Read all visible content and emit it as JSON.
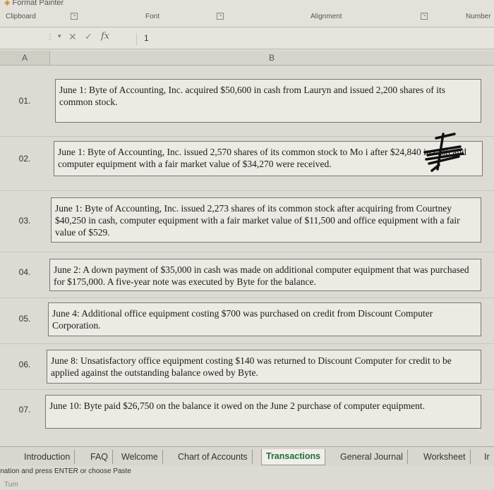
{
  "ribbon": {
    "format_painter": "Format Painter",
    "groups": [
      "Clipboard",
      "Font",
      "Alignment",
      "Number"
    ]
  },
  "formula_bar": {
    "value": "1"
  },
  "columns": [
    "A",
    "B"
  ],
  "rows": [
    {
      "num": "01.",
      "text": "June 1: Byte of Accounting, Inc. acquired $50,600 in cash from Lauryn and issued 2,200 shares of its common stock."
    },
    {
      "num": "02.",
      "text": "June 1: Byte of Accounting, Inc. issued 2,570 shares of its common stock to Mo      i after $24,840 in cash and computer equipment with a fair market value of $34,270 were received."
    },
    {
      "num": "03.",
      "text": "June 1: Byte of Accounting, Inc. issued 2,273 shares of its common stock after acquiring from Courtney $40,250 in cash, computer equipment with a fair market value of $11,500 and office equipment with a fair value of $529."
    },
    {
      "num": "04.",
      "text": "June 2: A down payment of $35,000 in cash was made on additional computer equipment that was purchased for $175,000. A five-year note was executed by Byte for the balance."
    },
    {
      "num": "05.",
      "text": "June 4: Additional office equipment costing $700 was purchased on credit from Discount Computer Corporation."
    },
    {
      "num": "06.",
      "text": "June 8: Unsatisfactory office equipment costing $140 was returned to Discount Computer for credit to be applied against the outstanding balance owed by Byte."
    },
    {
      "num": "07.",
      "text": "June 10: Byte paid $26,750 on the balance it owed on the June 2 purchase of computer equipment."
    }
  ],
  "tabs": [
    "Introduction",
    "FAQ",
    "Welcome",
    "Chart of Accounts",
    "Transactions",
    "General Journal",
    "Worksheet",
    "Ir"
  ],
  "active_tab": "Transactions",
  "status": {
    "text": "ination and press ENTER or choose Paste",
    "sub": "Tum"
  },
  "icons": {
    "format_painter": "paintbrush-icon",
    "cancel": "x-icon",
    "enter": "check-icon",
    "function": "fx-icon"
  }
}
